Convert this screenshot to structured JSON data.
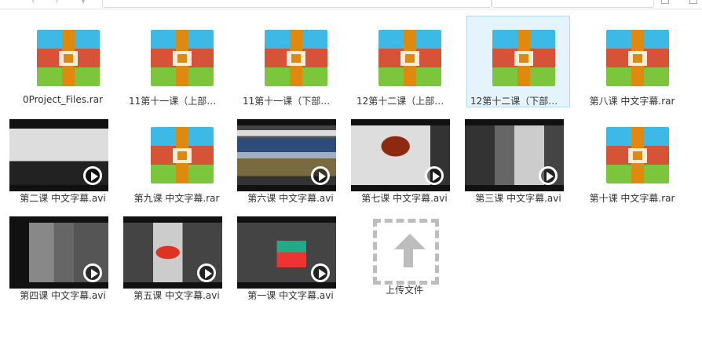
{
  "colors": {
    "rar_blue": "#3db9e6",
    "rar_red": "#d65338",
    "rar_green": "#7cc63d",
    "rar_strap": "#e0890f",
    "selected_bg": "#e5f3fc"
  },
  "files": [
    {
      "name": "0Project_Files.rar",
      "type": "rar"
    },
    {
      "name": "11第十一课（上部）...",
      "type": "rar"
    },
    {
      "name": "11第十一课（下部）...",
      "type": "rar"
    },
    {
      "name": "12第十二课（上部）...",
      "type": "rar"
    },
    {
      "name": "12第十二课（下部）...",
      "type": "rar",
      "selected": true
    },
    {
      "name": "第八课 中文字幕.rar",
      "type": "rar"
    },
    {
      "name": "第二课 中文字幕.avi",
      "type": "avi"
    },
    {
      "name": "第九课 中文字幕.rar",
      "type": "rar"
    },
    {
      "name": "第六课 中文字幕.avi",
      "type": "avi"
    },
    {
      "name": "第七课 中文字幕.avi",
      "type": "avi"
    },
    {
      "name": "第三课 中文字幕.avi",
      "type": "avi"
    },
    {
      "name": "第十课 中文字幕.rar",
      "type": "rar"
    },
    {
      "name": "第四课 中文字幕.avi",
      "type": "avi"
    },
    {
      "name": "第五课 中文字幕.avi",
      "type": "avi"
    },
    {
      "name": "第一课 中文字幕.avi",
      "type": "avi"
    }
  ],
  "upload": {
    "label": "上传文件"
  }
}
